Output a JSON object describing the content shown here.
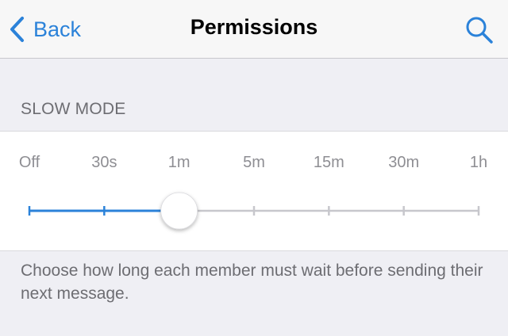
{
  "nav": {
    "back_label": "Back",
    "title": "Permissions",
    "search_icon": "search-icon",
    "accent_color": "#2b82d9"
  },
  "slow_mode": {
    "header": "SLOW MODE",
    "options": [
      "Off",
      "30s",
      "1m",
      "5m",
      "15m",
      "30m",
      "1h"
    ],
    "selected": "1m",
    "selected_index": 2,
    "active_color": "#2b82d9",
    "inactive_color": "#c7c7cc"
  },
  "footer": {
    "description": "Choose how long each member must wait before sending their next message."
  }
}
